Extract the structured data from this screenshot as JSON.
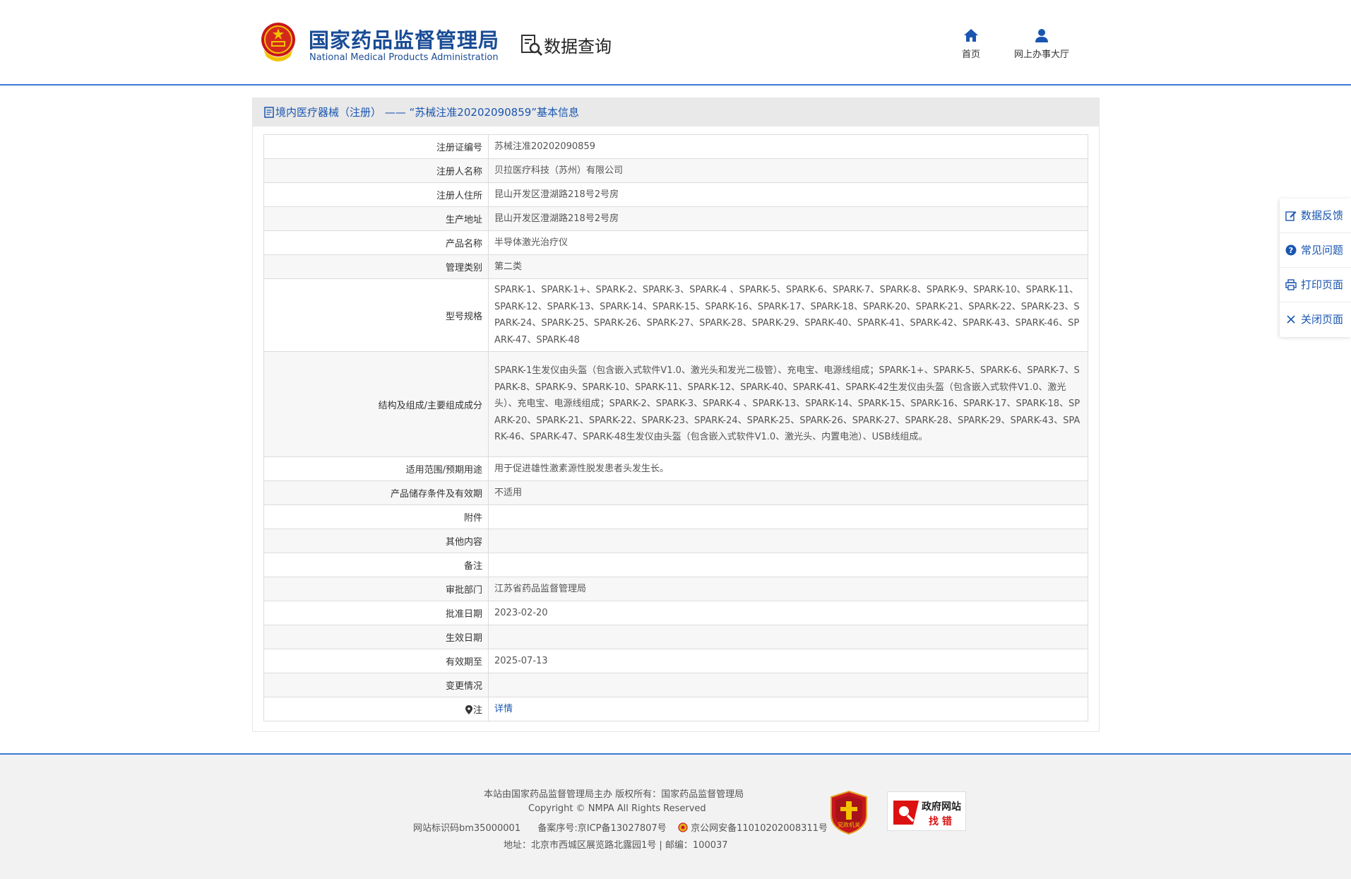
{
  "header": {
    "org_name_cn": "国家药品监督管理局",
    "org_name_en": "National Medical Products Administration",
    "section_title": "数据查询",
    "nav": [
      {
        "label": "首页",
        "icon": "home-icon"
      },
      {
        "label": "网上办事大厅",
        "icon": "user-icon"
      }
    ]
  },
  "panel": {
    "title": "境内医疗器械（注册） —— “苏械注准20202090859”基本信息",
    "rows": [
      {
        "label": "注册证编号",
        "value": "苏械注准20202090859"
      },
      {
        "label": "注册人名称",
        "value": "贝拉医疗科技（苏州）有限公司"
      },
      {
        "label": "注册人住所",
        "value": "昆山开发区澄湖路218号2号房"
      },
      {
        "label": "生产地址",
        "value": "昆山开发区澄湖路218号2号房"
      },
      {
        "label": "产品名称",
        "value": "半导体激光治疗仪"
      },
      {
        "label": "管理类别",
        "value": "第二类"
      },
      {
        "label": "型号规格",
        "value": "SPARK-1、SPARK-1+、SPARK-2、SPARK-3、SPARK-4 、SPARK-5、SPARK-6、SPARK-7、SPARK-8、SPARK-9、SPARK-10、SPARK-11、SPARK-12、SPARK-13、SPARK-14、SPARK-15、SPARK-16、SPARK-17、SPARK-18、SPARK-20、SPARK-21、SPARK-22、SPARK-23、SPARK-24、SPARK-25、SPARK-26、SPARK-27、SPARK-28、SPARK-29、SPARK-40、SPARK-41、SPARK-42、SPARK-43、SPARK-46、SPARK-47、SPARK-48"
      },
      {
        "label": "结构及组成/主要组成成分",
        "value": "SPARK-1生发仪由头盔（包含嵌入式软件V1.0、激光头和发光二极管）、充电宝、电源线组成；SPARK-1+、SPARK-5、SPARK-6、SPARK-7、SPARK-8、SPARK-9、SPARK-10、SPARK-11、SPARK-12、SPARK-40、SPARK-41、SPARK-42生发仪由头盔（包含嵌入式软件V1.0、激光头）、充电宝、电源线组成；SPARK-2、SPARK-3、SPARK-4 、SPARK-13、SPARK-14、SPARK-15、SPARK-16、SPARK-17、SPARK-18、SPARK-20、SPARK-21、SPARK-22、SPARK-23、SPARK-24、SPARK-25、SPARK-26、SPARK-27、SPARK-28、SPARK-29、SPARK-43、SPARK-46、SPARK-47、SPARK-48生发仪由头盔（包含嵌入式软件V1.0、激光头、内置电池）、USB线组成。"
      },
      {
        "label": "适用范围/预期用途",
        "value": "用于促进雄性激素源性脱发患者头发生长。"
      },
      {
        "label": "产品储存条件及有效期",
        "value": "不适用"
      },
      {
        "label": "附件",
        "value": ""
      },
      {
        "label": "其他内容",
        "value": ""
      },
      {
        "label": "备注",
        "value": ""
      },
      {
        "label": "审批部门",
        "value": "江苏省药品监督管理局"
      },
      {
        "label": "批准日期",
        "value": "2023-02-20"
      },
      {
        "label": "生效日期",
        "value": ""
      },
      {
        "label": "有效期至",
        "value": "2025-07-13"
      },
      {
        "label": "变更情况",
        "value": ""
      }
    ],
    "note_label": "注",
    "note_link": "详情"
  },
  "float_menu": [
    {
      "label": "数据反馈",
      "icon": "edit-icon"
    },
    {
      "label": "常见问题",
      "icon": "question-icon"
    },
    {
      "label": "打印页面",
      "icon": "printer-icon"
    },
    {
      "label": "关闭页面",
      "icon": "close-icon"
    }
  ],
  "footer": {
    "line1": "本站由国家药品监督管理局主办 版权所有：国家药品监督管理局",
    "line2": "Copyright © NMPA All Rights Reserved",
    "site_id": "网站标识码bm35000001",
    "icp": "备案序号:京ICP备13027807号",
    "police": "京公网安备11010202008311号",
    "line4": "地址：北京市西城区展览路北露园1号 | 邮编：100037",
    "badge_party": "党政机关",
    "badge_gov_1": "政府网站",
    "badge_gov_2": "找 错"
  },
  "colors": {
    "brand": "#1a4c96",
    "link": "#1a56b0",
    "header_rule": "#3a7bd5",
    "title_bar": "#e9e9e9",
    "footer_bg": "#f2f2f2"
  }
}
